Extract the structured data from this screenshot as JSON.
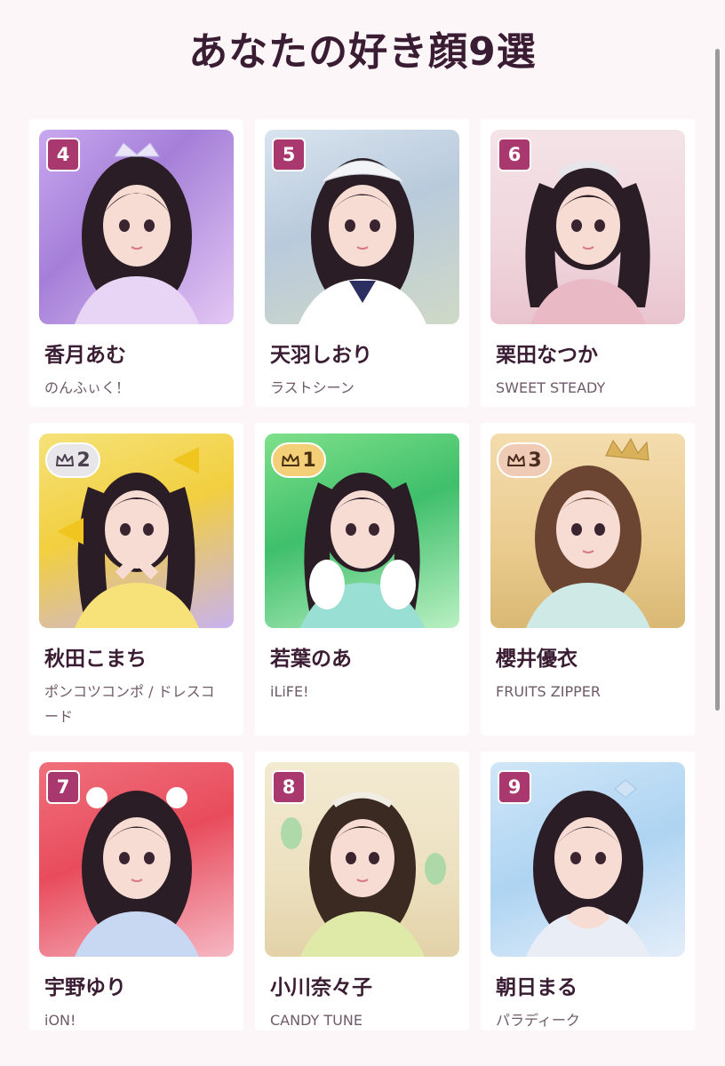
{
  "page": {
    "title": "あなたの好き顔9選"
  },
  "colors": {
    "background": "#fdf6f8",
    "card": "#ffffff",
    "rank_badge": "#a8386e",
    "title_text": "#3a1d33",
    "silver": "#e9e6ea",
    "gold": "#f3cf78",
    "bronze": "#efcbb6"
  },
  "cards": [
    {
      "rank": "4",
      "badge_type": "number",
      "name": "香月あむ",
      "group": "のんふぃく！",
      "photo_theme": "purple-fantasy"
    },
    {
      "rank": "5",
      "badge_type": "number",
      "name": "天羽しおり",
      "group": "ラストシーン",
      "photo_theme": "castle-pastel"
    },
    {
      "rank": "6",
      "badge_type": "number",
      "name": "栗田なつか",
      "group": "SWEET STEADY",
      "photo_theme": "pink-studio"
    },
    {
      "rank": "2",
      "badge_type": "crown-silver",
      "name": "秋田こまち",
      "group": "ポンコツコンポ / ドレスコード",
      "photo_theme": "yellow-ribbon"
    },
    {
      "rank": "1",
      "badge_type": "crown-gold",
      "name": "若葉のあ",
      "group": "iLiFE!",
      "photo_theme": "green-hearts"
    },
    {
      "rank": "3",
      "badge_type": "crown-bronze",
      "name": "櫻井優衣",
      "group": "FRUITS ZIPPER",
      "photo_theme": "gold-crown"
    },
    {
      "rank": "7",
      "badge_type": "number",
      "name": "宇野ゆり",
      "group": "iON!",
      "photo_theme": "red-pink"
    },
    {
      "rank": "8",
      "badge_type": "number",
      "name": "小川奈々子",
      "group": "CANDY TUNE",
      "photo_theme": "cream-candy"
    },
    {
      "rank": "9",
      "badge_type": "number",
      "name": "朝日まる",
      "group": "パラディーク",
      "photo_theme": "blue-sky"
    }
  ]
}
